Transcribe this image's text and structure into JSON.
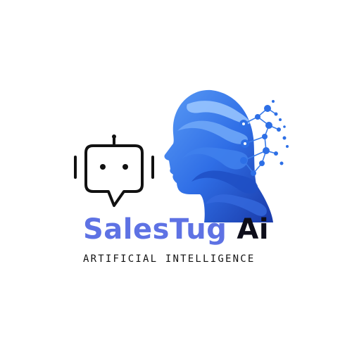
{
  "logo": {
    "brand_name_part1": "SalesTug",
    "brand_name_part2": "Ai",
    "tagline": "ARTIFICIAL INTELLIGENCE",
    "icons": [
      "robot-chat-icon",
      "ai-head-icon"
    ],
    "colors": {
      "brand_blue": "#5e72e4",
      "dark_text": "#0d0d1a",
      "head_light_blue": "#4f8df0",
      "head_deep_blue": "#1c3fb3",
      "network_blue": "#2d6fe6"
    }
  }
}
